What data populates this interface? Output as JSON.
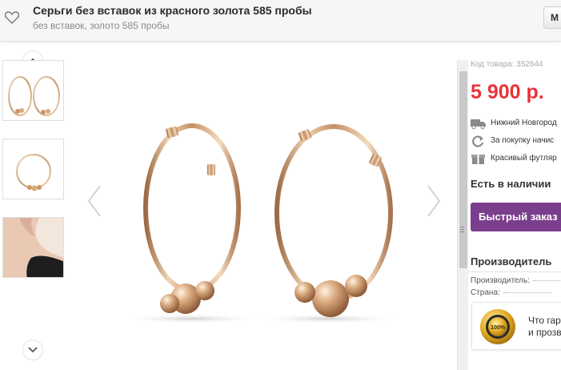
{
  "header": {
    "title": "Серьги без вставок из красного золота 585 пробы",
    "subtitle": "без вставок, золото 585 пробы",
    "right_button_label": "М"
  },
  "product": {
    "sku_text": "Код товара: 352644",
    "price": "5 900 р.",
    "features": [
      {
        "icon": "truck-icon",
        "text": "Нижний Новгород"
      },
      {
        "icon": "refresh-icon",
        "text": "За покупку начис"
      },
      {
        "icon": "gift-icon",
        "text": "Красивый футляр"
      }
    ],
    "stock_status": "Есть в наличии",
    "quick_order_label": "Быстрый заказ",
    "manufacturer": {
      "title": "Производитель",
      "fields": [
        {
          "label": "Производитель:"
        },
        {
          "label": "Страна:"
        }
      ]
    },
    "guarantee": {
      "line1": "Что гар",
      "line2": "и прозв"
    }
  },
  "gallery": {
    "thumbnails": [
      "pair-view",
      "single-view",
      "model-view"
    ]
  },
  "colors": {
    "price": "#e8333a",
    "quick_order_bg": "#7b3e8c",
    "gold": "#d9b58a"
  }
}
